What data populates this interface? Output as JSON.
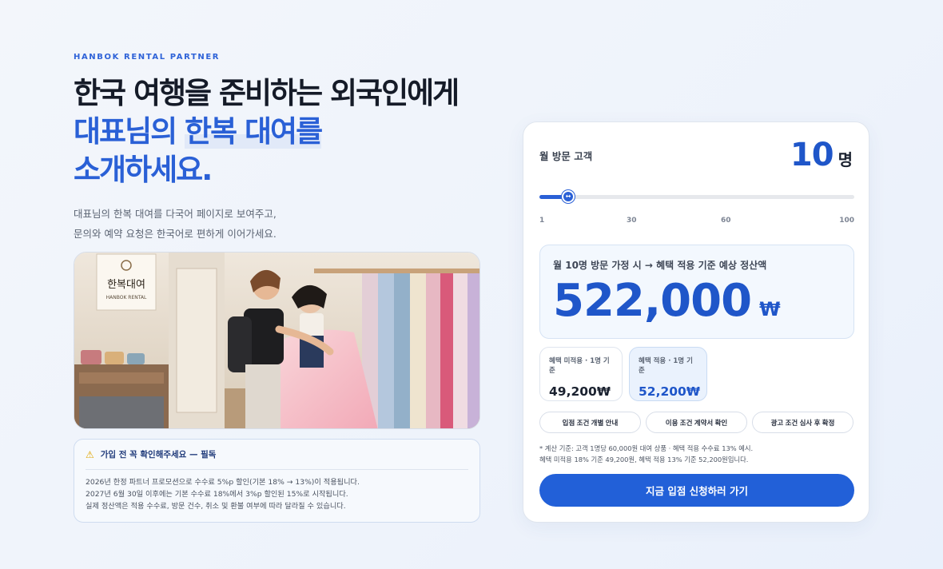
{
  "hero": {
    "eyebrow": "HANBOK RENTAL PARTNER",
    "headline_line1": "한국 여행을 준비하는 외국인에게",
    "headline_line2a": "대표님의 ",
    "headline_line2b": "한복 대여를",
    "headline_line3": "소개하세요.",
    "desc_line1": "대표님의 한복 대여를 다국어 페이지로 보여주고,",
    "desc_line2": "문의와 예약 요청은 한국어로 편하게 이어가세요."
  },
  "photo": {
    "sign_text": "한복대여",
    "sign_subtext": "HANBOK RENTAL"
  },
  "notice": {
    "icon": "warning-icon",
    "title": "가입 전 꼭 확인해주세요 — 필독",
    "lines": [
      "2026년 한정 파트너 프로모션으로 수수료 5%p 할인(기본 18% → 13%)이 적용됩니다.",
      "2027년 6월 30일 이후에는 기본 수수료 18%에서 3%p 할인된 15%로 시작됩니다.",
      "실제 정산액은 적용 수수료, 방문 건수, 취소 및 환불 여부에 따라 달라질 수 있습니다."
    ]
  },
  "calculator": {
    "visitors_label": "월 방문 고객",
    "visitors_value": "10",
    "visitors_unit": "명",
    "slider": {
      "min": 1,
      "max": 100,
      "value": 10,
      "thumb_icon": "↔"
    },
    "ticks": [
      "1",
      "30",
      "60",
      "100"
    ],
    "estimate_caption": "월 10명 방문 가정 시 → 혜택 적용 기준 예상 정산액",
    "estimate_amount": "522,000",
    "estimate_currency": "₩",
    "no_benefit_label": "혜택 미적용 · 1명 기준",
    "no_benefit_value": "49,200₩",
    "with_benefit_label": "혜택 적용 · 1명 기준",
    "with_benefit_value": "52,200₩",
    "chips": [
      "입점 조건 개별 안내",
      "이용 조건 계약서 확인",
      "광고 조건 심사 후 확정"
    ],
    "footnote_line1": "* 계산 기준: 고객 1명당 60,000원 대여 상품 · 혜택 적용 수수료 13% 예시.",
    "footnote_line2": "혜택 미적용 18% 기준 49,200원, 혜택 적용 13% 기준 52,200원입니다.",
    "cta_label": "지금 입점 신청하러 가기"
  },
  "colors": {
    "accent": "#2260d8",
    "accent_text": "#1f56c9",
    "warning": "#e0a500"
  }
}
